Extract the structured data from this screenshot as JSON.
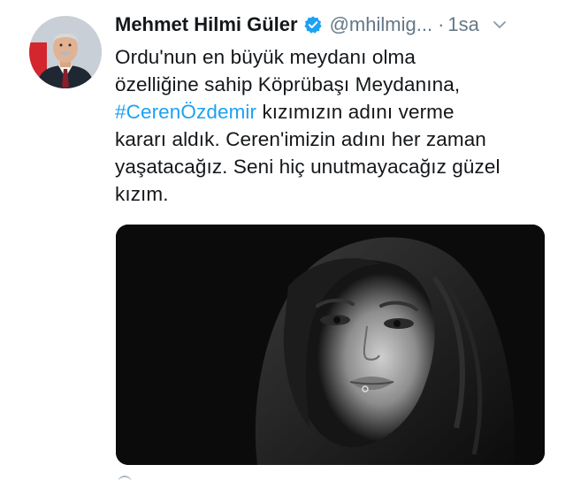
{
  "tweet": {
    "author": {
      "display_name": "Mehmet Hilmi Güler",
      "handle": "@mhilmig...",
      "verified": true
    },
    "separator": "·",
    "time": "1sa",
    "text_before": "Ordu'nun en büyük meydanı olma\nözelliğine sahip Köprübaşı Meydanına,\n",
    "hashtag": "#CerenÖzdemir",
    "text_after": " kızımızın adını verme\nkararı aldık. Ceren'imizin adını her zaman\nyaşatacağız. Seni hiç unutmayacağız güzel\nkızım.",
    "colors": {
      "accent": "#1da1f2",
      "text": "#14171a",
      "muted": "#657786"
    },
    "icons": {
      "verified": "verified-badge-icon",
      "menu": "chevron-down-icon"
    }
  }
}
